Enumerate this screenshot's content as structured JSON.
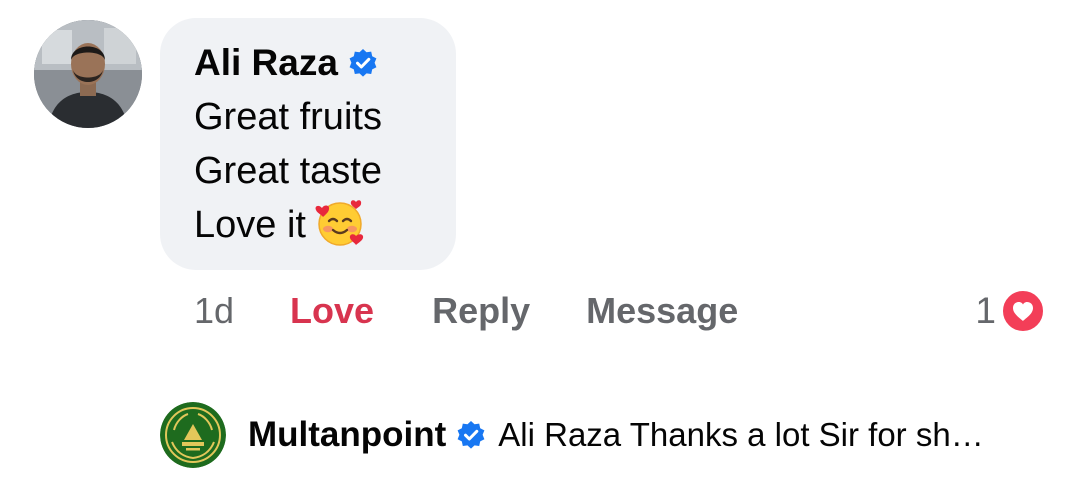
{
  "comment": {
    "author": "Ali Raza",
    "verified_icon": "verified-badge-icon",
    "lines": [
      "Great fruits",
      "Great taste",
      "Love it"
    ],
    "emoji": "smiling-face-with-hearts-emoji",
    "timestamp": "1d",
    "actions": {
      "love_label": "Love",
      "reply_label": "Reply",
      "message_label": "Message"
    },
    "reaction_count": "1",
    "reaction_icon": "love-reaction-icon"
  },
  "reply_preview": {
    "author": "Multanpoint",
    "verified_icon": "verified-badge-icon",
    "text": "Ali Raza Thanks a lot Sir for sh…"
  },
  "colors": {
    "bubble_bg": "#f0f2f5",
    "love_red": "#d8344f",
    "muted_gray": "#65676b",
    "verified_blue": "#1877f2",
    "reply_avatar_green": "#1e6b1e"
  }
}
